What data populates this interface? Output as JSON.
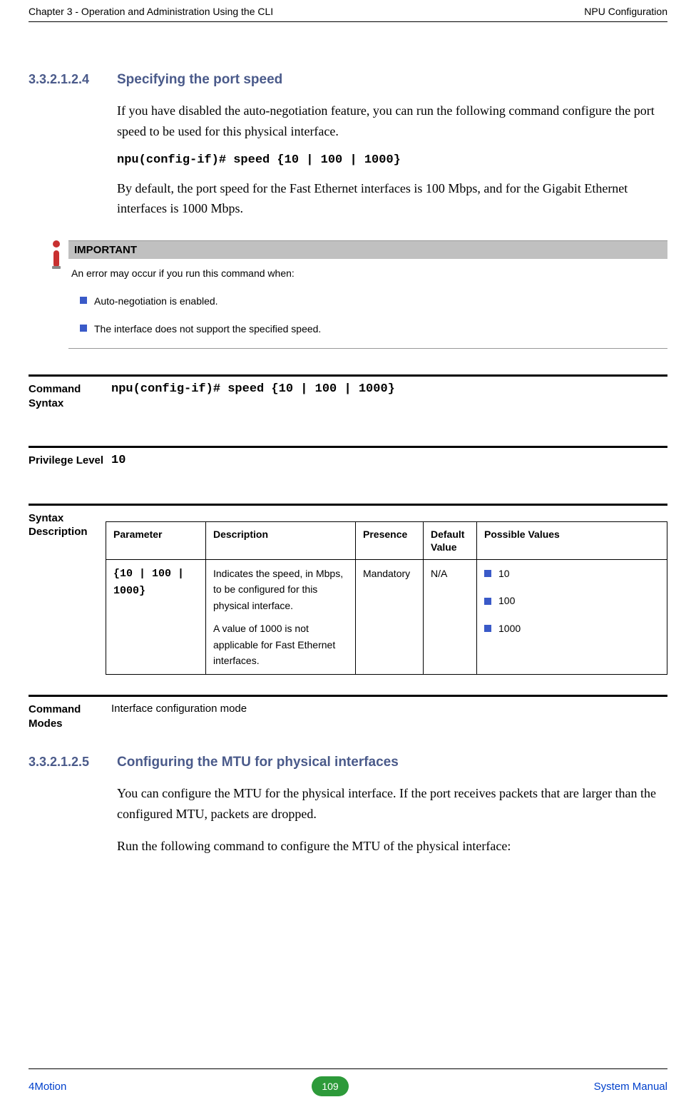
{
  "header": {
    "left": "Chapter 3 - Operation and Administration Using the CLI",
    "right": "NPU Configuration"
  },
  "section1": {
    "number": "3.3.2.1.2.4",
    "title": "Specifying the port speed",
    "p1": "If you have disabled the auto-negotiation feature, you can run the following command configure the port speed to be used for this physical interface.",
    "code": "npu(config-if)# speed {10 | 100 | 1000}",
    "p2": "By default, the port speed for the Fast Ethernet interfaces is 100 Mbps, and for the Gigabit Ethernet interfaces is 1000 Mbps."
  },
  "important": {
    "heading": "IMPORTANT",
    "intro": "An error may occur if you run this command when:",
    "items": [
      "Auto-negotiation is enabled.",
      "The interface does not support the specified speed."
    ]
  },
  "cmd_syntax": {
    "label": "Command Syntax",
    "value": "npu(config-if)# speed {10 | 100 | 1000}"
  },
  "privilege": {
    "label": "Privilege Level",
    "value": "10"
  },
  "syntax_desc": {
    "label": "Syntax Description",
    "headers": {
      "param": "Parameter",
      "desc": "Description",
      "presence": "Presence",
      "default": "Default Value",
      "possible": "Possible Values"
    },
    "row": {
      "param": "{10 | 100 | 1000}",
      "desc1": "Indicates the speed, in Mbps, to be configured for this physical interface.",
      "desc2": "A value of 1000 is not applicable for Fast Ethernet interfaces.",
      "presence": "Mandatory",
      "default": "N/A",
      "possible": [
        "10",
        "100",
        "1000"
      ]
    }
  },
  "cmd_modes": {
    "label": "Command Modes",
    "value": "Interface configuration mode"
  },
  "section2": {
    "number": "3.3.2.1.2.5",
    "title": "Configuring the MTU for physical interfaces",
    "p1": "You can configure the MTU for the physical interface. If the port receives packets that are larger than the configured MTU, packets are dropped.",
    "p2": "Run the following command to configure the MTU of the physical interface:"
  },
  "footer": {
    "left": "4Motion",
    "page": "109",
    "right": "System Manual"
  }
}
